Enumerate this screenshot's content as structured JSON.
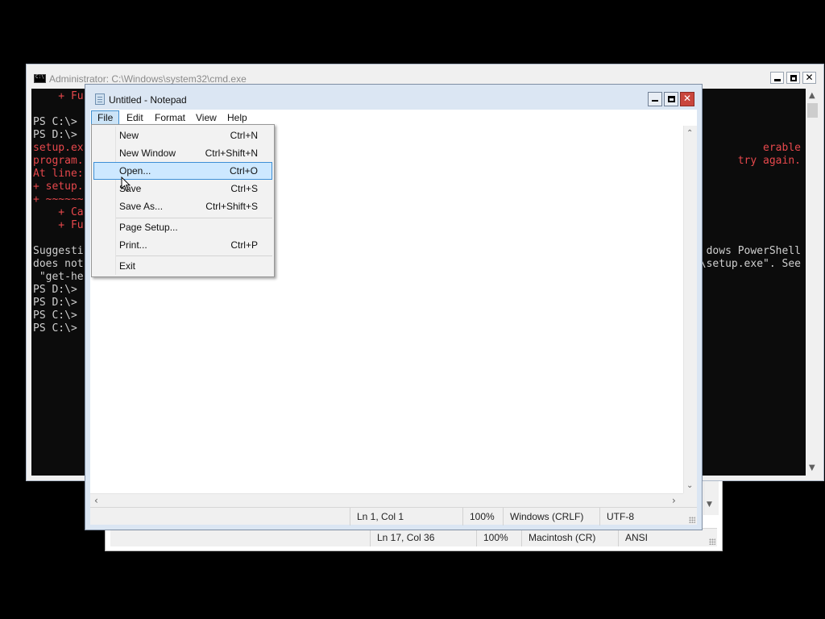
{
  "background_notepad": {
    "status": {
      "position": "Ln 17, Col 36",
      "zoom": "100%",
      "line_ending": "Macintosh (CR)",
      "encoding": "ANSI"
    }
  },
  "cmd_window": {
    "title": "Administrator: C:\\Windows\\system32\\cmd.exe",
    "lines": [
      {
        "text": "    + Fu",
        "color": "red"
      },
      {
        "text": "",
        "color": "default"
      },
      {
        "text": "PS C:\\>",
        "color": "default"
      },
      {
        "text": "PS D:\\>",
        "color": "default"
      },
      {
        "text": "setup.ex",
        "color": "red",
        "right": "erable"
      },
      {
        "text": "program.",
        "color": "red",
        "right": "try again."
      },
      {
        "text": "At line:",
        "color": "red"
      },
      {
        "text": "+ setup.",
        "color": "red"
      },
      {
        "text": "+ ~~~~~~",
        "color": "red"
      },
      {
        "text": "    + Ca",
        "color": "red"
      },
      {
        "text": "    + Fu",
        "color": "red"
      },
      {
        "text": "",
        "color": "default"
      },
      {
        "text": "Suggesti",
        "color": "default",
        "right": "dows PowerShell"
      },
      {
        "text": "does not",
        "color": "default",
        "right": "\\setup.exe\". See"
      },
      {
        "text": " \"get-he",
        "color": "default"
      },
      {
        "text": "PS D:\\>",
        "color": "default"
      },
      {
        "text": "PS D:\\>",
        "color": "default"
      },
      {
        "text": "PS C:\\>",
        "color": "default"
      },
      {
        "text": "PS C:\\>",
        "color": "default"
      }
    ]
  },
  "notepad": {
    "title": "Untitled - Notepad",
    "menubar": [
      "File",
      "Edit",
      "Format",
      "View",
      "Help"
    ],
    "status": {
      "position": "Ln 1, Col 1",
      "zoom": "100%",
      "line_ending": "Windows (CRLF)",
      "encoding": "UTF-8"
    }
  },
  "file_menu": {
    "items": [
      {
        "label": "New",
        "shortcut": "Ctrl+N"
      },
      {
        "label": "New Window",
        "shortcut": "Ctrl+Shift+N"
      },
      {
        "label": "Open...",
        "shortcut": "Ctrl+O",
        "highlighted": true
      },
      {
        "label": "Save",
        "shortcut": "Ctrl+S"
      },
      {
        "label": "Save As...",
        "shortcut": "Ctrl+Shift+S"
      },
      {
        "label": "Page Setup...",
        "shortcut": ""
      },
      {
        "label": "Print...",
        "shortcut": "Ctrl+P"
      },
      {
        "label": "Exit",
        "shortcut": ""
      }
    ]
  },
  "colors": {
    "console_red": "#e7484c",
    "console_text": "#cfcfcf",
    "menu_highlight": "#cde8ff",
    "close_button": "#c9463d"
  }
}
